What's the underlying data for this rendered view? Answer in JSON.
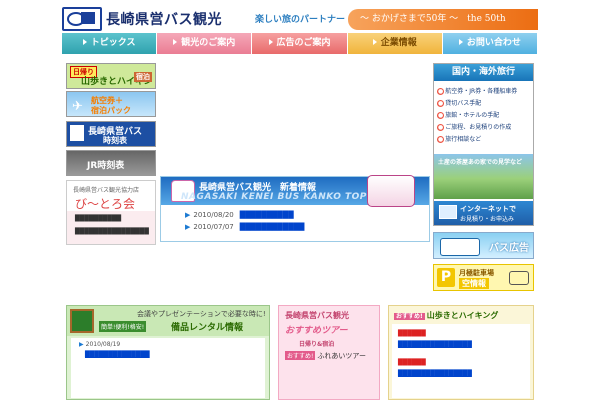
{
  "header": {
    "site_name": "長崎県営バス観光",
    "tagline": "楽しい旅のパートナー",
    "anniversary": "～ おかげさまで50年 ～　the 50th Anniversary"
  },
  "nav": {
    "items": [
      {
        "label": "トピックス"
      },
      {
        "label": "観光のご案内"
      },
      {
        "label": "広告のご案内"
      },
      {
        "label": "企業情報"
      },
      {
        "label": "お問い合わせ"
      }
    ]
  },
  "left": {
    "hike_banner": {
      "tag": "日帰り",
      "text": "山歩きとハイキング",
      "day": "宿泊"
    },
    "air_banner": {
      "line1": "航空券＋",
      "line2": "宿泊パック"
    },
    "timetable_banner": {
      "line1": "長崎県営バス",
      "line2": "時刻表"
    },
    "jr_banner": {
      "text": "JR時刻表"
    },
    "coop": {
      "heading": "長崎県営バス観光協力店",
      "name": "び～とろ会",
      "item1": "██████████",
      "item2": "████████████████"
    }
  },
  "news": {
    "title": "長崎県営バス観光　新着情報",
    "subtitle": "NAGASAKI KENEI BUS KANKO TOPICS",
    "items": [
      {
        "date": "2010/08/20",
        "text": "██████████"
      },
      {
        "date": "2010/07/07",
        "text": "████████████"
      }
    ]
  },
  "right": {
    "tour": {
      "header": "国内・海外旅行",
      "items": [
        "航空券・JR券・各種船車券",
        "貸切バス手配",
        "旅館・ホテルの手配",
        "ご旅程、お見積りの作成",
        "旅行相談など"
      ],
      "caption": "土産の茶屋あの家での見学など",
      "net_line1": "インターネットで",
      "net_line2": "お見積り・お申込み"
    },
    "bus_ad": "バス広告",
    "parking": {
      "p": "P",
      "line1": "月極駐車場",
      "line2": "空情報"
    }
  },
  "bottom": {
    "rental": {
      "line1": "会議やプレゼンテーションで必要な時に!",
      "tag": "簡単!便利!格安!",
      "title": "備品レンタル情報",
      "date": "2010/08/19",
      "link": "██████████████"
    },
    "promo": {
      "line1": "長崎県営バス観光",
      "line2": "おすすめツアー",
      "line3": "日帰り&宿泊",
      "badge": "おすすめ!",
      "line4": "ふれあいツアー"
    },
    "hike": {
      "badge": "おすすめ!",
      "title": "山歩きとハイキング",
      "rows": [
        {
          "text": "██████",
          "style": "red"
        },
        {
          "text": "████████████████",
          "style": "lnk"
        },
        {
          "text": "██████",
          "style": "red"
        },
        {
          "text": "████████████████",
          "style": "lnk"
        }
      ]
    }
  },
  "colors": {
    "brand_navy": "#1a2f6e",
    "accent_orange": "#ec6d12",
    "link_blue": "#0044cc"
  }
}
